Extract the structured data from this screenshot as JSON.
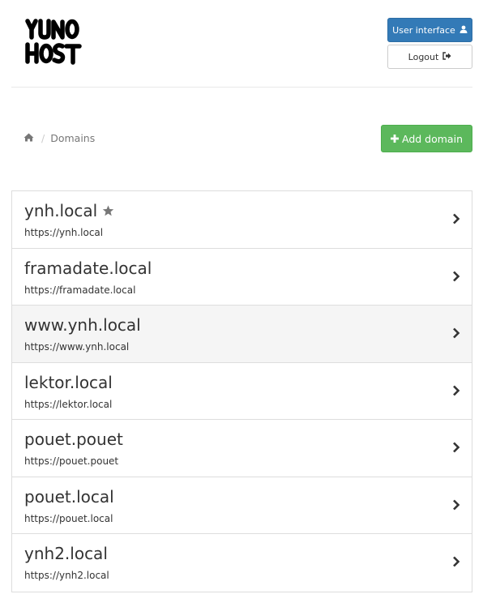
{
  "header": {
    "logo_text": "YUNO HOST",
    "user_interface_label": "User interface",
    "logout_label": "Logout"
  },
  "breadcrumb": {
    "current": "Domains"
  },
  "actions": {
    "add_domain_label": "Add domain"
  },
  "domains": [
    {
      "name": "ynh.local",
      "url": "https://ynh.local",
      "is_main": true
    },
    {
      "name": "framadate.local",
      "url": "https://framadate.local",
      "is_main": false
    },
    {
      "name": "www.ynh.local",
      "url": "https://www.ynh.local",
      "is_main": false
    },
    {
      "name": "lektor.local",
      "url": "https://lektor.local",
      "is_main": false
    },
    {
      "name": "pouet.pouet",
      "url": "https://pouet.pouet",
      "is_main": false
    },
    {
      "name": "pouet.local",
      "url": "https://pouet.local",
      "is_main": false
    },
    {
      "name": "ynh2.local",
      "url": "https://ynh2.local",
      "is_main": false
    }
  ],
  "icons": {
    "home": "home-icon",
    "user": "user-icon",
    "logout": "sign-out-icon",
    "plus": "plus-icon",
    "star": "star-icon",
    "chevron": "chevron-right-icon"
  },
  "colors": {
    "primary": "#337ab7",
    "success": "#5cb85c",
    "hover_row": "#f5f5f5"
  }
}
